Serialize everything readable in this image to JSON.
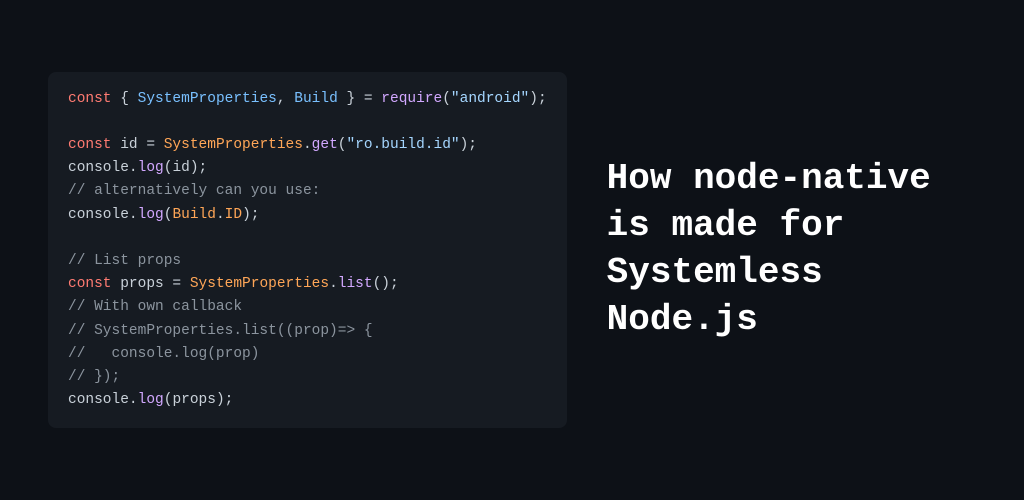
{
  "title": "How node-native is made for Systemless Node.js",
  "code": {
    "l1_kw": "const",
    "l1_brace_open": " { ",
    "l1_sysprops": "SystemProperties",
    "l1_comma": ", ",
    "l1_build": "Build",
    "l1_brace_close": " } ",
    "l1_eq": "= ",
    "l1_require": "require",
    "l1_paren_open": "(",
    "l1_str": "\"android\"",
    "l1_paren_close": ");",
    "l3_kw": "const",
    "l3_sp": " ",
    "l3_id": "id",
    "l3_eq": " = ",
    "l3_sys": "SystemProperties",
    "l3_dot": ".",
    "l3_get": "get",
    "l3_open": "(",
    "l3_str": "\"ro.build.id\"",
    "l3_close": ");",
    "l4_console": "console",
    "l4_dot": ".",
    "l4_log": "log",
    "l4_open": "(",
    "l4_arg": "id",
    "l4_close": ");",
    "l5_cmt": "// alternatively can you use:",
    "l6_console": "console",
    "l6_dot": ".",
    "l6_log": "log",
    "l6_open": "(",
    "l6_build": "Build",
    "l6_dot2": ".",
    "l6_ID": "ID",
    "l6_close": ");",
    "l8_cmt": "// List props",
    "l9_kw": "const",
    "l9_sp": " ",
    "l9_props": "props",
    "l9_eq": " = ",
    "l9_sys": "SystemProperties",
    "l9_dot": ".",
    "l9_list": "list",
    "l9_parens": "();",
    "l10_cmt": "// With own callback",
    "l11_cmt": "// SystemProperties.list((prop)=> {",
    "l12_cmt": "//   console.log(prop)",
    "l13_cmt": "// });",
    "l14_console": "console",
    "l14_dot": ".",
    "l14_log": "log",
    "l14_open": "(",
    "l14_arg": "props",
    "l14_close": ");"
  }
}
